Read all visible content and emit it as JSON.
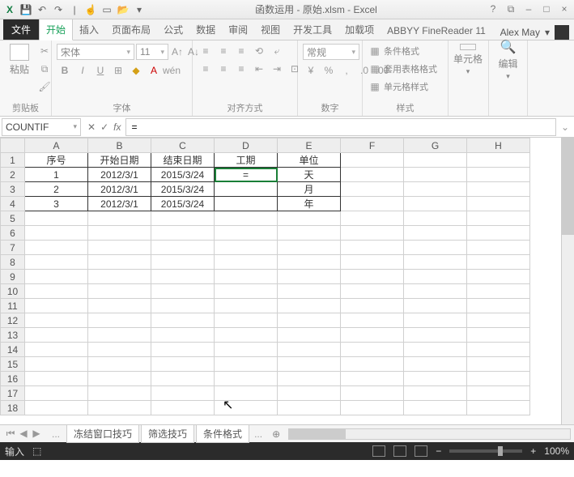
{
  "title": "函数运用 - 原始.xlsm - Excel",
  "qat_icons": [
    "xl",
    "save",
    "undo",
    "redo",
    "|",
    "touch",
    "new",
    "open",
    "|",
    "…"
  ],
  "win_icons": [
    "?",
    "⧉",
    "–",
    "□",
    "×"
  ],
  "tabs": {
    "file": "文件",
    "items": [
      "开始",
      "插入",
      "页面布局",
      "公式",
      "数据",
      "审阅",
      "视图",
      "开发工具",
      "加载项",
      "ABBYY FineReader 11"
    ],
    "active": 0
  },
  "user": {
    "name": "Alex May",
    "dd": "▾"
  },
  "ribbon": {
    "clipboard": {
      "title": "剪贴板",
      "paste": "粘贴"
    },
    "font": {
      "title": "字体",
      "name": "宋体",
      "size": "11",
      "btns": [
        "B",
        "I",
        "U",
        "⊞",
        "A",
        "Aˇ"
      ],
      "grow": [
        "Aᐃ",
        "Aᐁ",
        "wén/₋"
      ]
    },
    "align": {
      "title": "对齐方式",
      "btns": [
        "≡",
        "≡",
        "≡",
        "↺",
        "↻",
        "≣",
        "≣",
        "≣",
        "⤶",
        "⤷"
      ],
      "wrap": "⤶",
      "merge": "⊡"
    },
    "number": {
      "title": "数字",
      "fmt": "常规",
      "btns": [
        "¥",
        "%",
        ",",
        ".0←",
        ".00→"
      ]
    },
    "styles": {
      "title": "样式",
      "cond": "条件格式",
      "table": "套用表格格式",
      "cell": "单元格样式"
    },
    "cells": {
      "title": "单元格"
    },
    "editing": {
      "title": "编辑"
    }
  },
  "fx": {
    "name": "COUNTIF",
    "cancel": "✕",
    "ok": "✓",
    "fx": "fx",
    "input": "="
  },
  "sheet": {
    "cols": [
      "A",
      "B",
      "C",
      "D",
      "E",
      "F",
      "G",
      "H"
    ],
    "rows": 18,
    "data": [
      [
        "序号",
        "开始日期",
        "结束日期",
        "工期",
        "单位"
      ],
      [
        "1",
        "2012/3/1",
        "2015/3/24",
        "=",
        "天"
      ],
      [
        "2",
        "2012/3/1",
        "2015/3/24",
        "",
        "月"
      ],
      [
        "3",
        "2012/3/1",
        "2015/3/24",
        "",
        "年"
      ]
    ],
    "active": {
      "r": 2,
      "c": 4
    }
  },
  "sheetTabs": {
    "items": [
      "冻结窗口技巧",
      "筛选技巧",
      "条件格式"
    ],
    "dots": "..."
  },
  "status": {
    "mode": "输入",
    "macro": "⬚",
    "zoom": "100%"
  }
}
